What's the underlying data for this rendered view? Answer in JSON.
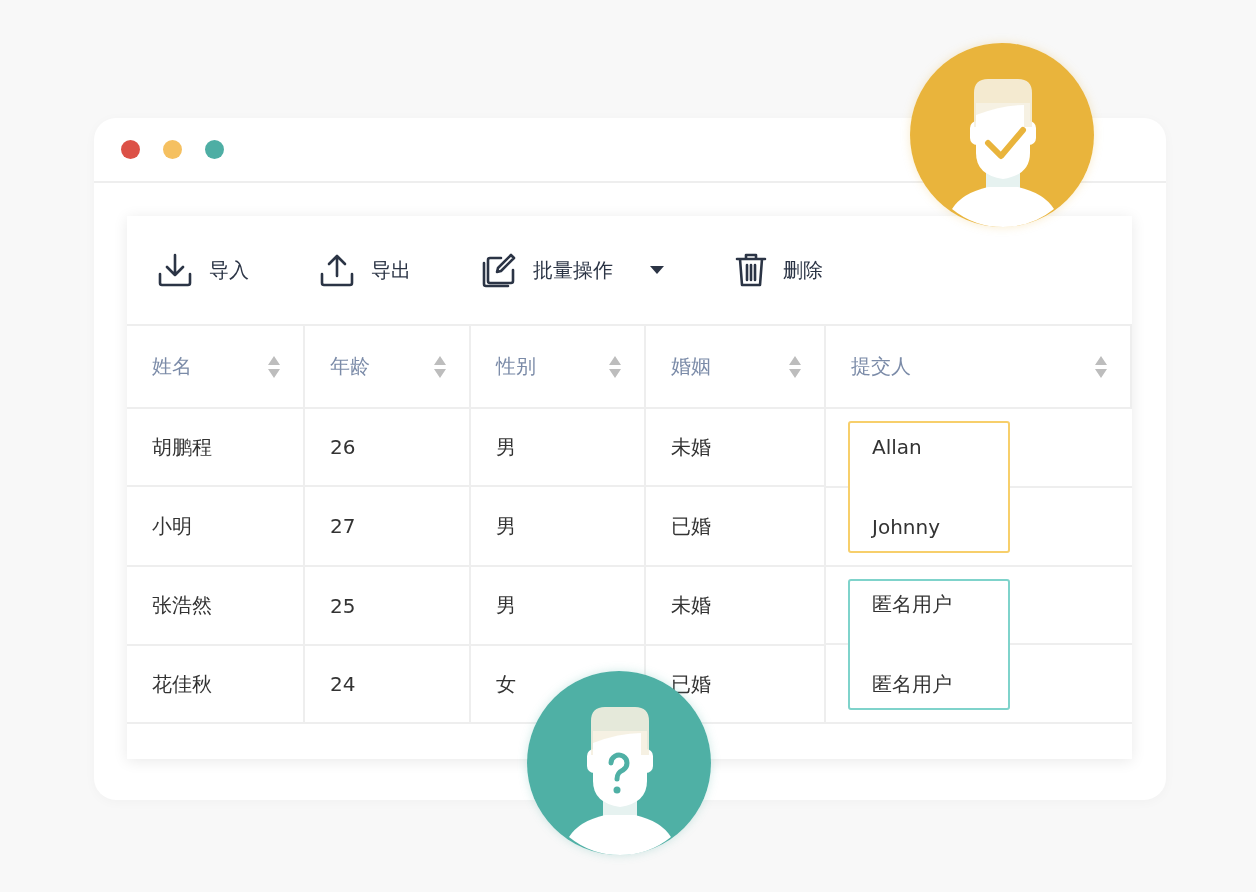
{
  "window": {
    "controls": [
      {
        "color": "#dc5147"
      },
      {
        "color": "#f5c060"
      },
      {
        "color": "#4eaea4"
      }
    ]
  },
  "toolbar": [
    {
      "label": "导入",
      "kind": "import",
      "dropdown": false
    },
    {
      "label": "导出",
      "kind": "export",
      "dropdown": false
    },
    {
      "label": "批量操作",
      "kind": "edit",
      "dropdown": true
    },
    {
      "label": "删除",
      "kind": "delete",
      "dropdown": false
    }
  ],
  "table": {
    "columns": [
      {
        "label": "姓名",
        "sortable": true
      },
      {
        "label": "年龄",
        "sortable": true
      },
      {
        "label": "性别",
        "sortable": true
      },
      {
        "label": "婚姻",
        "sortable": true
      },
      {
        "label": "提交人",
        "sortable": true
      }
    ],
    "rows": [
      {
        "cells": [
          "胡鹏程",
          "26",
          "男",
          "未婚"
        ]
      },
      {
        "cells": [
          "小明",
          "27",
          "男",
          "已婚"
        ]
      },
      {
        "cells": [
          "张浩然",
          "25",
          "男",
          "未婚"
        ]
      },
      {
        "cells": [
          "花佳秋",
          "24",
          "女",
          "已婚"
        ]
      }
    ],
    "submitter_groups": [
      {
        "color": "#f7cf6b",
        "names": [
          "Allan",
          "Johnny"
        ]
      },
      {
        "color": "#7fd3cb",
        "names": [
          "匿名用户",
          "匿名用户"
        ]
      }
    ]
  },
  "avatars": [
    {
      "kind": "verified",
      "color": "#e9b43c"
    },
    {
      "kind": "unknown",
      "color": "#4fb0a5"
    }
  ]
}
